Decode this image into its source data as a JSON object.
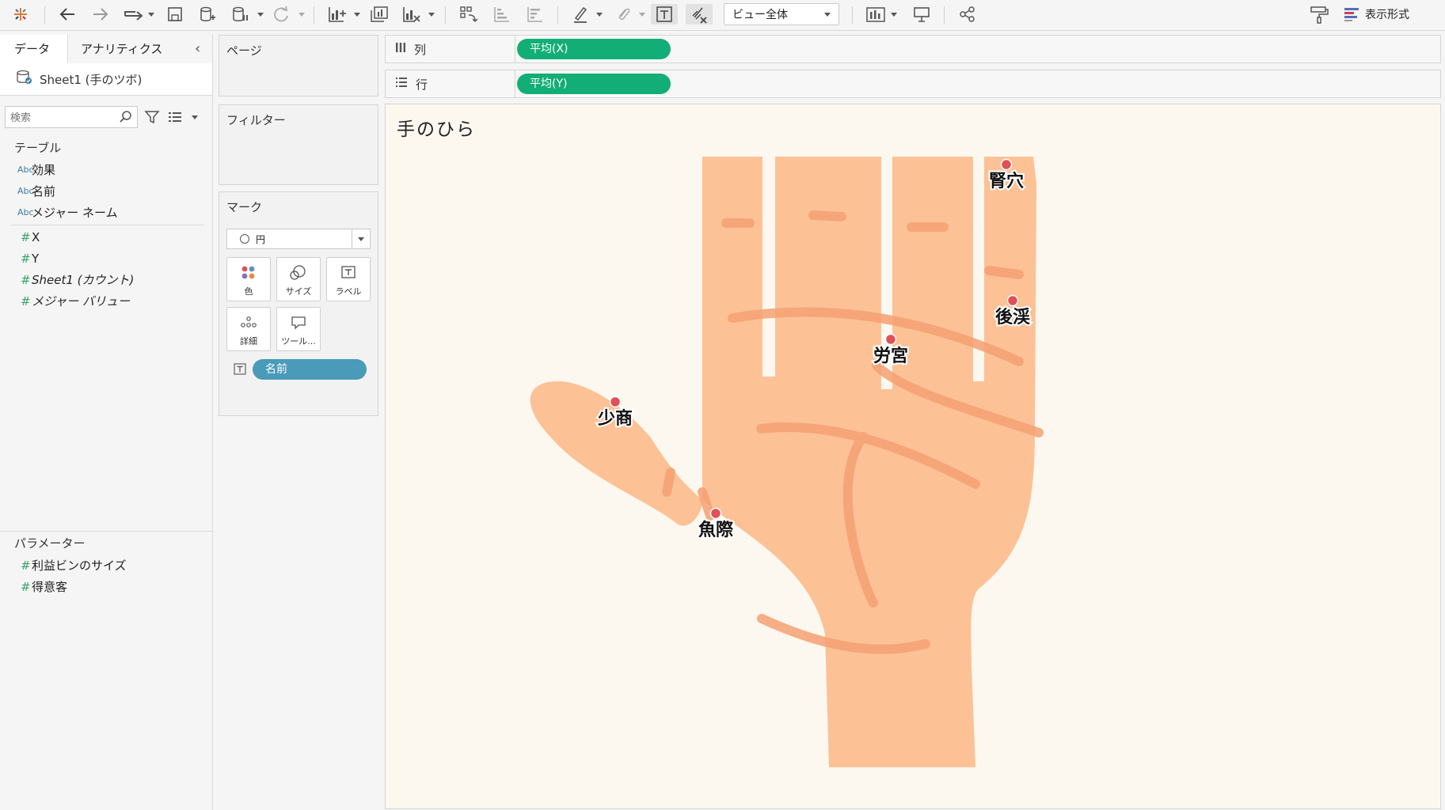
{
  "toolbar": {
    "view_select": "ビュー全体",
    "format_label": "表示形式"
  },
  "data_pane": {
    "tabs": [
      "データ",
      "アナリティクス"
    ],
    "datasource": "Sheet1 (手のツボ)",
    "search_placeholder": "検索",
    "table_heading": "テーブル",
    "dimensions": [
      {
        "type": "Abc",
        "name": "効果"
      },
      {
        "type": "Abc",
        "name": "名前"
      },
      {
        "type": "Abc",
        "name": "メジャー ネーム"
      }
    ],
    "measures": [
      {
        "type": "#",
        "name": "X"
      },
      {
        "type": "#",
        "name": "Y"
      },
      {
        "type": "#",
        "name": "Sheet1 (カウント)"
      },
      {
        "type": "#",
        "name": "メジャー バリュー"
      }
    ],
    "parameters_heading": "パラメーター",
    "parameters": [
      "利益ビンのサイズ",
      "得意客"
    ]
  },
  "cards": {
    "pages": "ページ",
    "filters": "フィルター",
    "marks": "マーク",
    "mark_type": "円",
    "mark_buttons": [
      "色",
      "サイズ",
      "ラベル",
      "詳細",
      "ツール..."
    ],
    "label_pill": "名前"
  },
  "shelves": {
    "columns_label": "列",
    "columns_pill": "平均(X)",
    "rows_label": "行",
    "rows_pill": "平均(Y)"
  },
  "viz": {
    "title": "手のひら",
    "point_color": "#e05058",
    "points": [
      {
        "name": "腎穴"
      },
      {
        "name": "後渓"
      },
      {
        "name": "労宮"
      },
      {
        "name": "少商"
      },
      {
        "name": "魚際"
      }
    ]
  },
  "colors": {
    "pill_green": "#13ae78",
    "pill_blue": "#4a9ab9",
    "hand_fill": "#fdc196",
    "hand_line": "#f5a173"
  }
}
